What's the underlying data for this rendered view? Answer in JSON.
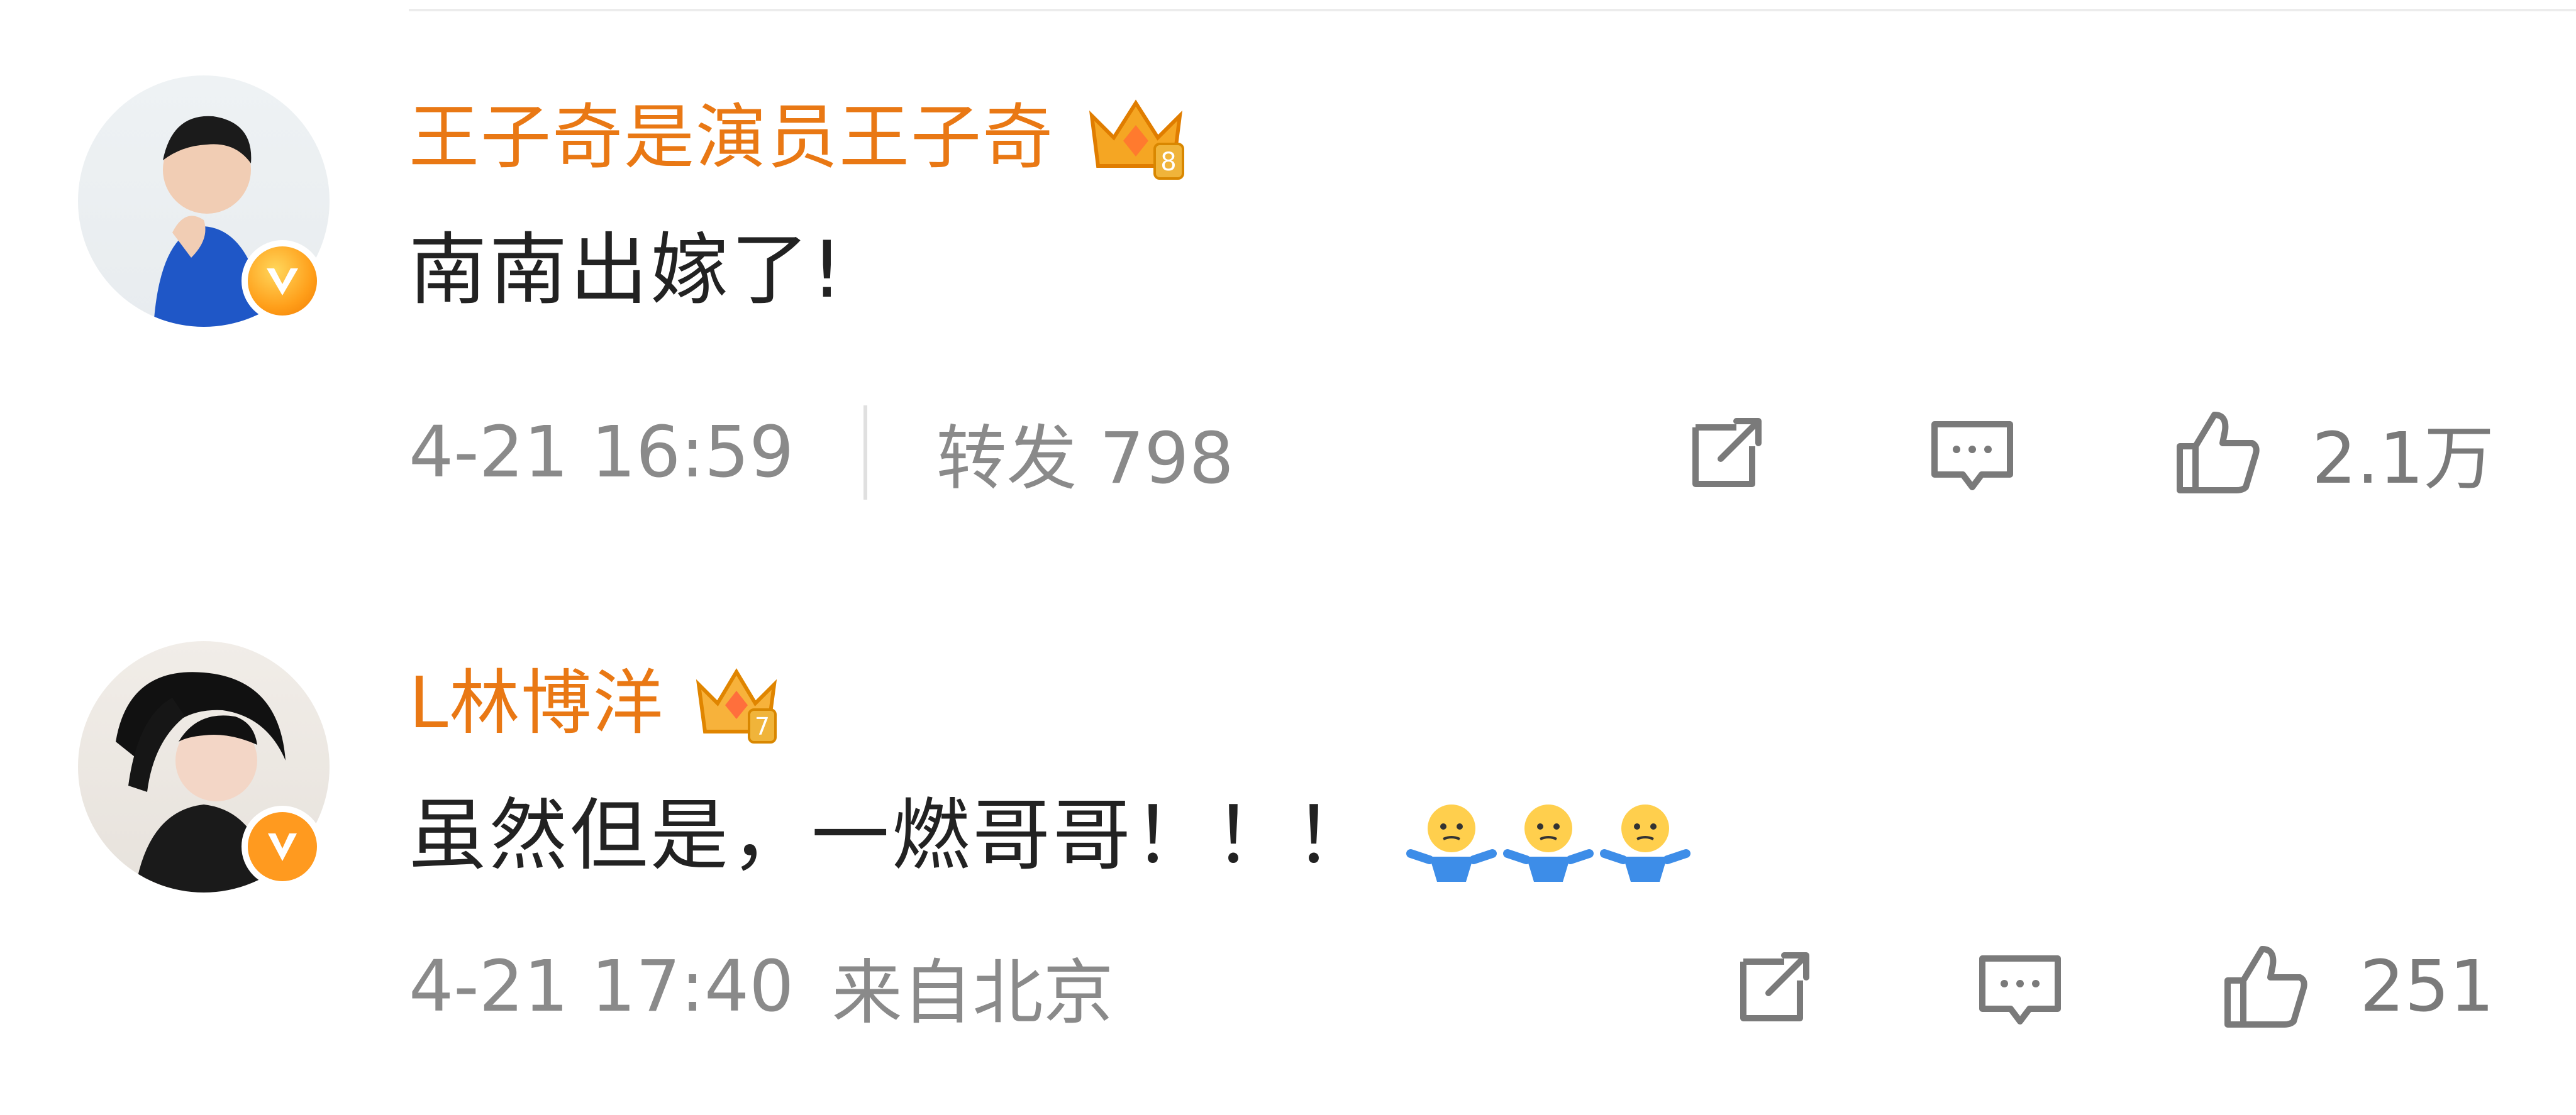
{
  "comments": [
    {
      "username": "王子奇是演员王子奇",
      "badge_level": "8",
      "text": "南南出嫁了!",
      "time": "4-21 16:59",
      "repost_label": "转发 798",
      "like_count": "2.1万",
      "name_color": "#e97814"
    },
    {
      "username": "L林博洋",
      "badge_level": "7",
      "text": "虽然但是，一燃哥哥！！！",
      "emoji_count": 3,
      "time": "4-21 17:40",
      "location": "来自北京",
      "like_count": "251",
      "name_color": "#e97814"
    }
  ],
  "icons": [
    "verified-v-icon",
    "crown-badge-icon",
    "share-icon",
    "comment-icon",
    "like-thumb-icon",
    "shrug-emoji-icon"
  ]
}
